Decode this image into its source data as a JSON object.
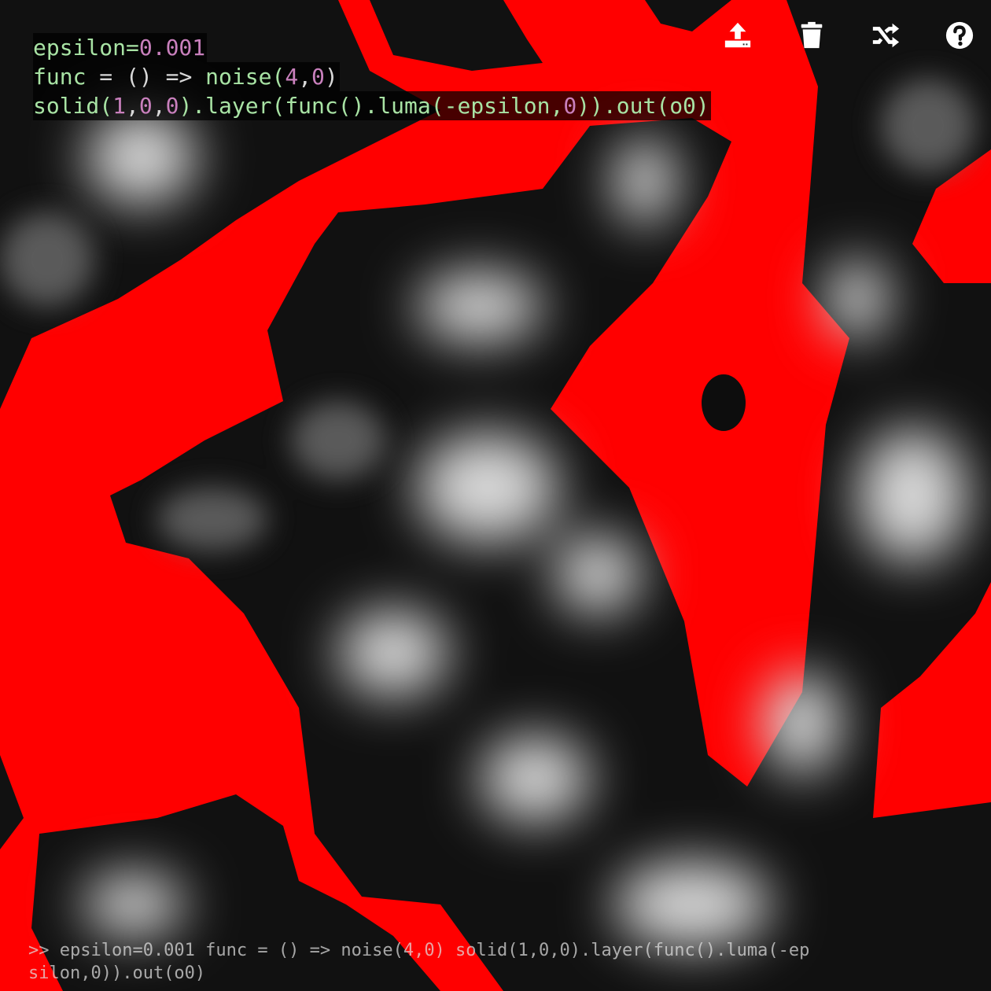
{
  "editor": {
    "lines": [
      [
        {
          "t": "epsilon=",
          "k": "text"
        },
        {
          "t": "0.001",
          "k": "num"
        }
      ],
      [
        {
          "t": "func ",
          "k": "text"
        },
        {
          "t": "= () =>",
          "k": "punc"
        },
        {
          "t": " noise(",
          "k": "text"
        },
        {
          "t": "4",
          "k": "num"
        },
        {
          "t": ",",
          "k": "punc"
        },
        {
          "t": "0",
          "k": "num"
        },
        {
          "t": ")",
          "k": "punc"
        }
      ],
      [
        {
          "t": "solid(",
          "k": "text"
        },
        {
          "t": "1",
          "k": "num"
        },
        {
          "t": ",",
          "k": "punc"
        },
        {
          "t": "0",
          "k": "num"
        },
        {
          "t": ",",
          "k": "punc"
        },
        {
          "t": "0",
          "k": "num"
        },
        {
          "t": ").layer(func().luma(-epsilon,",
          "k": "text"
        },
        {
          "t": "0",
          "k": "num"
        },
        {
          "t": ")).out(o0)",
          "k": "text"
        }
      ]
    ]
  },
  "toolbar": {
    "buttons": [
      {
        "name": "upload-icon"
      },
      {
        "name": "trash-icon"
      },
      {
        "name": "shuffle-icon"
      },
      {
        "name": "help-icon"
      }
    ]
  },
  "console": {
    "text": ">> epsilon=0.001 func = () => noise(4,0) solid(1,0,0).layer(func().luma(-epsilon,0)).out(o0)"
  },
  "colors": {
    "background": "#ff0000",
    "code_text": "#a8e3a4",
    "code_number": "#c980bd",
    "code_bg": "rgba(0,0,0,0.72)"
  }
}
